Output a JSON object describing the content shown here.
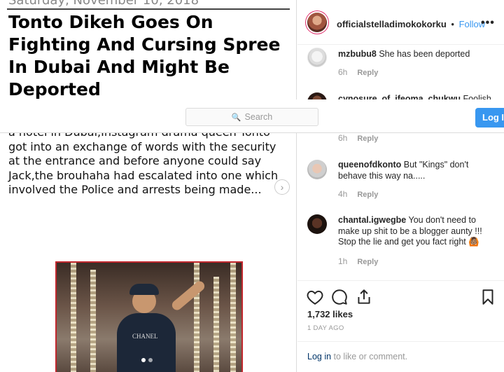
{
  "article": {
    "dateline": "Saturday, November 10, 2018",
    "headline": [
      "Tonto Dikeh Goes On",
      "Fighting And Cursing Spree",
      "In Dubai And Might Be",
      "Deported"
    ],
    "body": [
      "a hotel in Dubai,Instagram drama queen Tonto",
      "got into an exchange of words with the security",
      "at the entrance and before anyone could say",
      "Jack,the brouhaha had escalated into one which",
      "involved the Police and arrests being made..."
    ],
    "photo_brand": "CHANEL"
  },
  "post": {
    "username": "officialstelladimokokorku",
    "separator": "•",
    "follow_label": "Follow",
    "more": "•••"
  },
  "comments": [
    {
      "user": "mzbubu8",
      "text": "She has been deported",
      "time": "6h",
      "reply": "Reply"
    },
    {
      "user": "cynosure_of_ifeoma_chukwu",
      "text": "Foolish",
      "time": "6h",
      "reply": "Reply"
    },
    {
      "user": "queenofdkonto",
      "text": "But \"Kings\" don't behave this way na.....",
      "time": "4h",
      "reply": "Reply"
    },
    {
      "user": "chantal.igwegbe",
      "text": "You don't need to make up shit to be a blogger aunty !!! Stop the lie and get you fact right 🙆🏽",
      "time": "1h",
      "reply": "Reply"
    }
  ],
  "nav": {
    "search_placeholder": "Search",
    "login_button": "Log In"
  },
  "actions": {
    "likes": "1,732 likes",
    "ago": "1 DAY AGO",
    "login_link": "Log in",
    "login_suffix": " to like or comment."
  },
  "colors": {
    "accent": "#3897f0",
    "photo_border": "#c1272d"
  }
}
